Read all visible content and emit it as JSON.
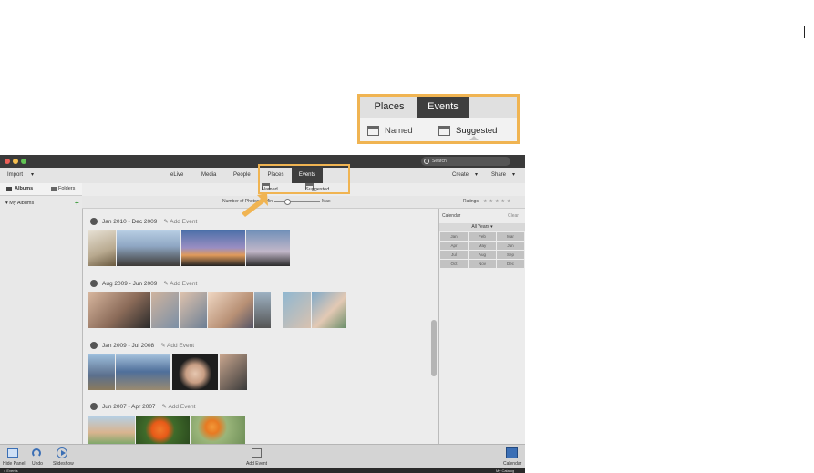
{
  "callout": {
    "places_tab": "Places",
    "events_tab": "Events",
    "named_label": "Named",
    "suggested_label": "Suggested"
  },
  "window": {
    "search_placeholder": "Search",
    "menu": {
      "import": "Import",
      "elive": "eLive",
      "media": "Media",
      "people": "People",
      "places": "Places",
      "events": "Events",
      "create": "Create",
      "share": "Share"
    },
    "subtabs": {
      "named": "Named",
      "suggested": "Suggested"
    },
    "sort": {
      "number_label": "Number of Photos",
      "min": "Min",
      "max": "Max",
      "ratings": "Ratings"
    },
    "sidebar": {
      "albums": "Albums",
      "folders": "Folders",
      "my_albums": "My Albums"
    },
    "events": [
      {
        "range": "Jan 2010 - Dec 2009",
        "add": "Add Event"
      },
      {
        "range": "Aug 2009 - Jun 2009",
        "add": "Add Event"
      },
      {
        "range": "Jan 2009 - Jul 2008",
        "add": "Add Event"
      },
      {
        "range": "Jun 2007 - Apr 2007",
        "add": "Add Event"
      }
    ],
    "calendar": {
      "title": "Calendar",
      "clear": "Clear",
      "years": "All Years",
      "months": [
        "Jan",
        "Feb",
        "Mar",
        "Apr",
        "May",
        "Jun",
        "Jul",
        "Aug",
        "Sep",
        "Oct",
        "Nov",
        "Dec"
      ]
    },
    "bottombar": {
      "hide_panel": "Hide Panel",
      "undo": "Undo",
      "slideshow": "Slideshow",
      "add_event": "Add Event",
      "calendar": "Calendar"
    },
    "status": {
      "left": "4 Events",
      "right": "My Catalog"
    }
  },
  "colors": {
    "highlight": "#f0b452",
    "active_tab": "#3e3e3e",
    "accent": "#3b6fb5"
  }
}
